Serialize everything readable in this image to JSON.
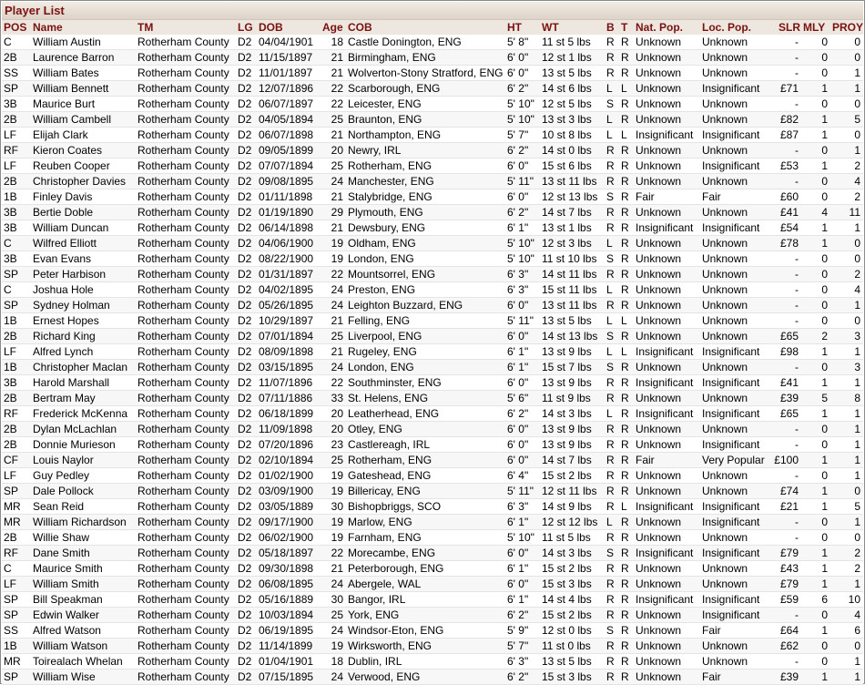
{
  "window": {
    "title": "Player List"
  },
  "columns": {
    "pos": "POS",
    "name": "Name",
    "tm": "TM",
    "lg": "LG",
    "dob": "DOB",
    "age": "Age",
    "cob": "COB",
    "ht": "HT",
    "wt": "WT",
    "b": "B",
    "t": "T",
    "nat": "Nat. Pop.",
    "loc": "Loc. Pop.",
    "slr": "SLR",
    "mly": "MLY",
    "prov": "PROY"
  },
  "players": [
    {
      "pos": "C",
      "name": "William Austin",
      "tm": "Rotherham County",
      "lg": "D2",
      "dob": "04/04/1901",
      "age": "18",
      "cob": "Castle Donington, ENG",
      "ht": "5' 8\"",
      "wt": "11 st 5 lbs",
      "b": "R",
      "t": "R",
      "nat": "Unknown",
      "loc": "Unknown",
      "slr": "-",
      "mly": "0",
      "prov": "0"
    },
    {
      "pos": "2B",
      "name": "Laurence Barron",
      "tm": "Rotherham County",
      "lg": "D2",
      "dob": "11/15/1897",
      "age": "21",
      "cob": "Birmingham, ENG",
      "ht": "6' 0\"",
      "wt": "12 st 1 lbs",
      "b": "R",
      "t": "R",
      "nat": "Unknown",
      "loc": "Unknown",
      "slr": "-",
      "mly": "0",
      "prov": "0"
    },
    {
      "pos": "SS",
      "name": "William Bates",
      "tm": "Rotherham County",
      "lg": "D2",
      "dob": "11/01/1897",
      "age": "21",
      "cob": "Wolverton-Stony Stratford, ENG",
      "ht": "6' 0\"",
      "wt": "13 st 5 lbs",
      "b": "R",
      "t": "R",
      "nat": "Unknown",
      "loc": "Unknown",
      "slr": "-",
      "mly": "0",
      "prov": "1"
    },
    {
      "pos": "SP",
      "name": "William Bennett",
      "tm": "Rotherham County",
      "lg": "D2",
      "dob": "12/07/1896",
      "age": "22",
      "cob": "Scarborough, ENG",
      "ht": "6' 2\"",
      "wt": "14 st 6 lbs",
      "b": "L",
      "t": "L",
      "nat": "Unknown",
      "loc": "Insignificant",
      "slr": "£71",
      "mly": "1",
      "prov": "1"
    },
    {
      "pos": "3B",
      "name": "Maurice Burt",
      "tm": "Rotherham County",
      "lg": "D2",
      "dob": "06/07/1897",
      "age": "22",
      "cob": "Leicester, ENG",
      "ht": "5' 10\"",
      "wt": "12 st 5 lbs",
      "b": "S",
      "t": "R",
      "nat": "Unknown",
      "loc": "Unknown",
      "slr": "-",
      "mly": "0",
      "prov": "0"
    },
    {
      "pos": "2B",
      "name": "William Cambell",
      "tm": "Rotherham County",
      "lg": "D2",
      "dob": "04/05/1894",
      "age": "25",
      "cob": "Braunton, ENG",
      "ht": "5' 10\"",
      "wt": "13 st 3 lbs",
      "b": "L",
      "t": "R",
      "nat": "Unknown",
      "loc": "Unknown",
      "slr": "£82",
      "mly": "1",
      "prov": "5"
    },
    {
      "pos": "LF",
      "name": "Elijah Clark",
      "tm": "Rotherham County",
      "lg": "D2",
      "dob": "06/07/1898",
      "age": "21",
      "cob": "Northampton, ENG",
      "ht": "5' 7\"",
      "wt": "10 st 8 lbs",
      "b": "L",
      "t": "L",
      "nat": "Insignificant",
      "loc": "Insignificant",
      "slr": "£87",
      "mly": "1",
      "prov": "0"
    },
    {
      "pos": "RF",
      "name": "Kieron Coates",
      "tm": "Rotherham County",
      "lg": "D2",
      "dob": "09/05/1899",
      "age": "20",
      "cob": "Newry, IRL",
      "ht": "6' 2\"",
      "wt": "14 st 0 lbs",
      "b": "R",
      "t": "R",
      "nat": "Unknown",
      "loc": "Unknown",
      "slr": "-",
      "mly": "0",
      "prov": "1"
    },
    {
      "pos": "LF",
      "name": "Reuben Cooper",
      "tm": "Rotherham County",
      "lg": "D2",
      "dob": "07/07/1894",
      "age": "25",
      "cob": "Rotherham, ENG",
      "ht": "6' 0\"",
      "wt": "15 st 6 lbs",
      "b": "R",
      "t": "R",
      "nat": "Unknown",
      "loc": "Insignificant",
      "slr": "£53",
      "mly": "1",
      "prov": "2"
    },
    {
      "pos": "2B",
      "name": "Christopher Davies",
      "tm": "Rotherham County",
      "lg": "D2",
      "dob": "09/08/1895",
      "age": "24",
      "cob": "Manchester, ENG",
      "ht": "5' 11\"",
      "wt": "13 st 11 lbs",
      "b": "R",
      "t": "R",
      "nat": "Unknown",
      "loc": "Unknown",
      "slr": "-",
      "mly": "0",
      "prov": "4"
    },
    {
      "pos": "1B",
      "name": "Finley Davis",
      "tm": "Rotherham County",
      "lg": "D2",
      "dob": "01/11/1898",
      "age": "21",
      "cob": "Stalybridge, ENG",
      "ht": "6' 0\"",
      "wt": "12 st 13 lbs",
      "b": "S",
      "t": "R",
      "nat": "Fair",
      "loc": "Fair",
      "slr": "£60",
      "mly": "0",
      "prov": "2"
    },
    {
      "pos": "3B",
      "name": "Bertie Doble",
      "tm": "Rotherham County",
      "lg": "D2",
      "dob": "01/19/1890",
      "age": "29",
      "cob": "Plymouth, ENG",
      "ht": "6' 2\"",
      "wt": "14 st 7 lbs",
      "b": "R",
      "t": "R",
      "nat": "Unknown",
      "loc": "Unknown",
      "slr": "£41",
      "mly": "4",
      "prov": "11"
    },
    {
      "pos": "3B",
      "name": "William Duncan",
      "tm": "Rotherham County",
      "lg": "D2",
      "dob": "06/14/1898",
      "age": "21",
      "cob": "Dewsbury, ENG",
      "ht": "6' 1\"",
      "wt": "13 st 1 lbs",
      "b": "R",
      "t": "R",
      "nat": "Insignificant",
      "loc": "Insignificant",
      "slr": "£54",
      "mly": "1",
      "prov": "1"
    },
    {
      "pos": "C",
      "name": "Wilfred Elliott",
      "tm": "Rotherham County",
      "lg": "D2",
      "dob": "04/06/1900",
      "age": "19",
      "cob": "Oldham, ENG",
      "ht": "5' 10\"",
      "wt": "12 st 3 lbs",
      "b": "L",
      "t": "R",
      "nat": "Unknown",
      "loc": "Unknown",
      "slr": "£78",
      "mly": "1",
      "prov": "0"
    },
    {
      "pos": "3B",
      "name": "Evan Evans",
      "tm": "Rotherham County",
      "lg": "D2",
      "dob": "08/22/1900",
      "age": "19",
      "cob": "London, ENG",
      "ht": "5' 10\"",
      "wt": "11 st 10 lbs",
      "b": "S",
      "t": "R",
      "nat": "Unknown",
      "loc": "Unknown",
      "slr": "-",
      "mly": "0",
      "prov": "0"
    },
    {
      "pos": "SP",
      "name": "Peter Harbison",
      "tm": "Rotherham County",
      "lg": "D2",
      "dob": "01/31/1897",
      "age": "22",
      "cob": "Mountsorrel, ENG",
      "ht": "6' 3\"",
      "wt": "14 st 11 lbs",
      "b": "R",
      "t": "R",
      "nat": "Unknown",
      "loc": "Unknown",
      "slr": "-",
      "mly": "0",
      "prov": "2"
    },
    {
      "pos": "C",
      "name": "Joshua Hole",
      "tm": "Rotherham County",
      "lg": "D2",
      "dob": "04/02/1895",
      "age": "24",
      "cob": "Preston, ENG",
      "ht": "6' 3\"",
      "wt": "15 st 11 lbs",
      "b": "L",
      "t": "R",
      "nat": "Unknown",
      "loc": "Unknown",
      "slr": "-",
      "mly": "0",
      "prov": "4"
    },
    {
      "pos": "SP",
      "name": "Sydney Holman",
      "tm": "Rotherham County",
      "lg": "D2",
      "dob": "05/26/1895",
      "age": "24",
      "cob": "Leighton Buzzard, ENG",
      "ht": "6' 0\"",
      "wt": "13 st 11 lbs",
      "b": "R",
      "t": "R",
      "nat": "Unknown",
      "loc": "Unknown",
      "slr": "-",
      "mly": "0",
      "prov": "1"
    },
    {
      "pos": "1B",
      "name": "Ernest Hopes",
      "tm": "Rotherham County",
      "lg": "D2",
      "dob": "10/29/1897",
      "age": "21",
      "cob": "Felling, ENG",
      "ht": "5' 11\"",
      "wt": "13 st 5 lbs",
      "b": "L",
      "t": "L",
      "nat": "Unknown",
      "loc": "Unknown",
      "slr": "-",
      "mly": "0",
      "prov": "0"
    },
    {
      "pos": "2B",
      "name": "Richard King",
      "tm": "Rotherham County",
      "lg": "D2",
      "dob": "07/01/1894",
      "age": "25",
      "cob": "Liverpool, ENG",
      "ht": "6' 0\"",
      "wt": "14 st 13 lbs",
      "b": "S",
      "t": "R",
      "nat": "Unknown",
      "loc": "Unknown",
      "slr": "£65",
      "mly": "2",
      "prov": "3"
    },
    {
      "pos": "LF",
      "name": "Alfred Lynch",
      "tm": "Rotherham County",
      "lg": "D2",
      "dob": "08/09/1898",
      "age": "21",
      "cob": "Rugeley, ENG",
      "ht": "6' 1\"",
      "wt": "13 st 9 lbs",
      "b": "L",
      "t": "L",
      "nat": "Insignificant",
      "loc": "Insignificant",
      "slr": "£98",
      "mly": "1",
      "prov": "1"
    },
    {
      "pos": "1B",
      "name": "Christopher Maclan",
      "tm": "Rotherham County",
      "lg": "D2",
      "dob": "03/15/1895",
      "age": "24",
      "cob": "London, ENG",
      "ht": "6' 1\"",
      "wt": "15 st 7 lbs",
      "b": "S",
      "t": "R",
      "nat": "Unknown",
      "loc": "Unknown",
      "slr": "-",
      "mly": "0",
      "prov": "3"
    },
    {
      "pos": "3B",
      "name": "Harold Marshall",
      "tm": "Rotherham County",
      "lg": "D2",
      "dob": "11/07/1896",
      "age": "22",
      "cob": "Southminster, ENG",
      "ht": "6' 0\"",
      "wt": "13 st 9 lbs",
      "b": "R",
      "t": "R",
      "nat": "Insignificant",
      "loc": "Insignificant",
      "slr": "£41",
      "mly": "1",
      "prov": "1"
    },
    {
      "pos": "2B",
      "name": "Bertram May",
      "tm": "Rotherham County",
      "lg": "D2",
      "dob": "07/11/1886",
      "age": "33",
      "cob": "St. Helens, ENG",
      "ht": "5' 6\"",
      "wt": "11 st 9 lbs",
      "b": "R",
      "t": "R",
      "nat": "Unknown",
      "loc": "Unknown",
      "slr": "£39",
      "mly": "5",
      "prov": "8"
    },
    {
      "pos": "RF",
      "name": "Frederick McKenna",
      "tm": "Rotherham County",
      "lg": "D2",
      "dob": "06/18/1899",
      "age": "20",
      "cob": "Leatherhead, ENG",
      "ht": "6' 2\"",
      "wt": "14 st 3 lbs",
      "b": "L",
      "t": "R",
      "nat": "Insignificant",
      "loc": "Insignificant",
      "slr": "£65",
      "mly": "1",
      "prov": "1"
    },
    {
      "pos": "2B",
      "name": "Dylan McLachlan",
      "tm": "Rotherham County",
      "lg": "D2",
      "dob": "11/09/1898",
      "age": "20",
      "cob": "Otley, ENG",
      "ht": "6' 0\"",
      "wt": "13 st 9 lbs",
      "b": "R",
      "t": "R",
      "nat": "Unknown",
      "loc": "Unknown",
      "slr": "-",
      "mly": "0",
      "prov": "1"
    },
    {
      "pos": "2B",
      "name": "Donnie Murieson",
      "tm": "Rotherham County",
      "lg": "D2",
      "dob": "07/20/1896",
      "age": "23",
      "cob": "Castlereagh, IRL",
      "ht": "6' 0\"",
      "wt": "13 st 9 lbs",
      "b": "R",
      "t": "R",
      "nat": "Unknown",
      "loc": "Insignificant",
      "slr": "-",
      "mly": "0",
      "prov": "1"
    },
    {
      "pos": "CF",
      "name": "Louis Naylor",
      "tm": "Rotherham County",
      "lg": "D2",
      "dob": "02/10/1894",
      "age": "25",
      "cob": "Rotherham, ENG",
      "ht": "6' 0\"",
      "wt": "14 st 7 lbs",
      "b": "R",
      "t": "R",
      "nat": "Fair",
      "loc": "Very Popular",
      "slr": "£100",
      "mly": "1",
      "prov": "1"
    },
    {
      "pos": "LF",
      "name": "Guy Pedley",
      "tm": "Rotherham County",
      "lg": "D2",
      "dob": "01/02/1900",
      "age": "19",
      "cob": "Gateshead, ENG",
      "ht": "6' 4\"",
      "wt": "15 st 2 lbs",
      "b": "R",
      "t": "R",
      "nat": "Unknown",
      "loc": "Unknown",
      "slr": "-",
      "mly": "0",
      "prov": "1"
    },
    {
      "pos": "SP",
      "name": "Dale Pollock",
      "tm": "Rotherham County",
      "lg": "D2",
      "dob": "03/09/1900",
      "age": "19",
      "cob": "Billericay, ENG",
      "ht": "5' 11\"",
      "wt": "12 st 11 lbs",
      "b": "R",
      "t": "R",
      "nat": "Unknown",
      "loc": "Unknown",
      "slr": "£74",
      "mly": "1",
      "prov": "0"
    },
    {
      "pos": "MR",
      "name": "Sean Reid",
      "tm": "Rotherham County",
      "lg": "D2",
      "dob": "03/05/1889",
      "age": "30",
      "cob": "Bishopbriggs, SCO",
      "ht": "6' 3\"",
      "wt": "14 st 9 lbs",
      "b": "R",
      "t": "L",
      "nat": "Insignificant",
      "loc": "Insignificant",
      "slr": "£21",
      "mly": "1",
      "prov": "5"
    },
    {
      "pos": "MR",
      "name": "William Richardson",
      "tm": "Rotherham County",
      "lg": "D2",
      "dob": "09/17/1900",
      "age": "19",
      "cob": "Marlow, ENG",
      "ht": "6' 1\"",
      "wt": "12 st 12 lbs",
      "b": "L",
      "t": "R",
      "nat": "Unknown",
      "loc": "Insignificant",
      "slr": "-",
      "mly": "0",
      "prov": "1"
    },
    {
      "pos": "2B",
      "name": "Willie Shaw",
      "tm": "Rotherham County",
      "lg": "D2",
      "dob": "06/02/1900",
      "age": "19",
      "cob": "Farnham, ENG",
      "ht": "5' 10\"",
      "wt": "11 st 5 lbs",
      "b": "R",
      "t": "R",
      "nat": "Unknown",
      "loc": "Unknown",
      "slr": "-",
      "mly": "0",
      "prov": "0"
    },
    {
      "pos": "RF",
      "name": "Dane Smith",
      "tm": "Rotherham County",
      "lg": "D2",
      "dob": "05/18/1897",
      "age": "22",
      "cob": "Morecambe, ENG",
      "ht": "6' 0\"",
      "wt": "14 st 3 lbs",
      "b": "S",
      "t": "R",
      "nat": "Insignificant",
      "loc": "Insignificant",
      "slr": "£79",
      "mly": "1",
      "prov": "2"
    },
    {
      "pos": "C",
      "name": "Maurice Smith",
      "tm": "Rotherham County",
      "lg": "D2",
      "dob": "09/30/1898",
      "age": "21",
      "cob": "Peterborough, ENG",
      "ht": "6' 1\"",
      "wt": "15 st 2 lbs",
      "b": "R",
      "t": "R",
      "nat": "Unknown",
      "loc": "Unknown",
      "slr": "£43",
      "mly": "1",
      "prov": "2"
    },
    {
      "pos": "LF",
      "name": "William Smith",
      "tm": "Rotherham County",
      "lg": "D2",
      "dob": "06/08/1895",
      "age": "24",
      "cob": "Abergele, WAL",
      "ht": "6' 0\"",
      "wt": "15 st 3 lbs",
      "b": "R",
      "t": "R",
      "nat": "Unknown",
      "loc": "Unknown",
      "slr": "£79",
      "mly": "1",
      "prov": "1"
    },
    {
      "pos": "SP",
      "name": "Bill Speakman",
      "tm": "Rotherham County",
      "lg": "D2",
      "dob": "05/16/1889",
      "age": "30",
      "cob": "Bangor, IRL",
      "ht": "6' 1\"",
      "wt": "14 st 4 lbs",
      "b": "R",
      "t": "R",
      "nat": "Insignificant",
      "loc": "Insignificant",
      "slr": "£59",
      "mly": "6",
      "prov": "10"
    },
    {
      "pos": "SP",
      "name": "Edwin Walker",
      "tm": "Rotherham County",
      "lg": "D2",
      "dob": "10/03/1894",
      "age": "25",
      "cob": "York, ENG",
      "ht": "6' 2\"",
      "wt": "15 st 2 lbs",
      "b": "R",
      "t": "R",
      "nat": "Unknown",
      "loc": "Insignificant",
      "slr": "-",
      "mly": "0",
      "prov": "4"
    },
    {
      "pos": "SS",
      "name": "Alfred Watson",
      "tm": "Rotherham County",
      "lg": "D2",
      "dob": "06/19/1895",
      "age": "24",
      "cob": "Windsor-Eton, ENG",
      "ht": "5' 9\"",
      "wt": "12 st 0 lbs",
      "b": "S",
      "t": "R",
      "nat": "Unknown",
      "loc": "Fair",
      "slr": "£64",
      "mly": "1",
      "prov": "6"
    },
    {
      "pos": "1B",
      "name": "William Watson",
      "tm": "Rotherham County",
      "lg": "D2",
      "dob": "11/14/1899",
      "age": "19",
      "cob": "Wirksworth, ENG",
      "ht": "5' 7\"",
      "wt": "11 st 0 lbs",
      "b": "R",
      "t": "R",
      "nat": "Unknown",
      "loc": "Unknown",
      "slr": "£62",
      "mly": "0",
      "prov": "0"
    },
    {
      "pos": "MR",
      "name": "Toirealach Whelan",
      "tm": "Rotherham County",
      "lg": "D2",
      "dob": "01/04/1901",
      "age": "18",
      "cob": "Dublin, IRL",
      "ht": "6' 3\"",
      "wt": "13 st 5 lbs",
      "b": "R",
      "t": "R",
      "nat": "Unknown",
      "loc": "Unknown",
      "slr": "-",
      "mly": "0",
      "prov": "1"
    },
    {
      "pos": "SP",
      "name": "William Wise",
      "tm": "Rotherham County",
      "lg": "D2",
      "dob": "07/15/1895",
      "age": "24",
      "cob": "Verwood, ENG",
      "ht": "6' 2\"",
      "wt": "15 st 3 lbs",
      "b": "R",
      "t": "R",
      "nat": "Unknown",
      "loc": "Fair",
      "slr": "£39",
      "mly": "1",
      "prov": "1"
    }
  ]
}
